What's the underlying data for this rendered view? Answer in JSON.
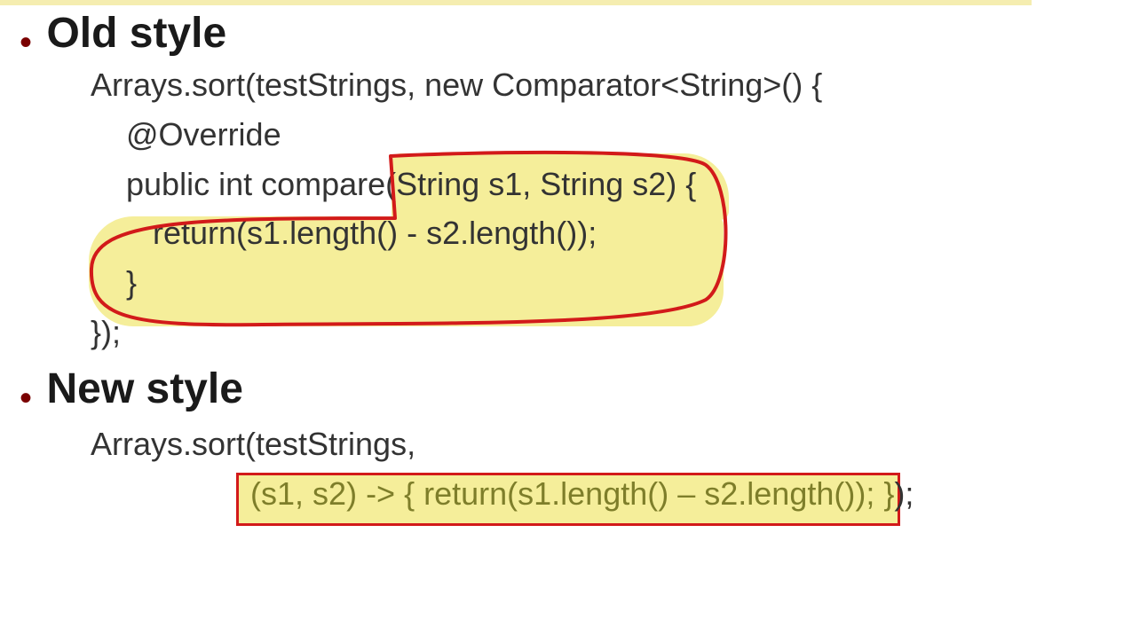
{
  "sec1": {
    "title": "Old style",
    "line1": "Arrays.sort(testStrings, new Comparator<String>() {",
    "line2": "    @Override",
    "line3": "    public int compare(String s1, String s2) {",
    "line4": "       return(s1.length() - s2.length());",
    "line5": "    }",
    "line6": "});"
  },
  "sec2": {
    "title": "New style",
    "line1": "Arrays.sort(testStrings,",
    "line2_a": "                  ",
    "line2_b": "(s1, s2) -> { return(s1.length() – s2.length()); }",
    "line2_c": ");"
  }
}
